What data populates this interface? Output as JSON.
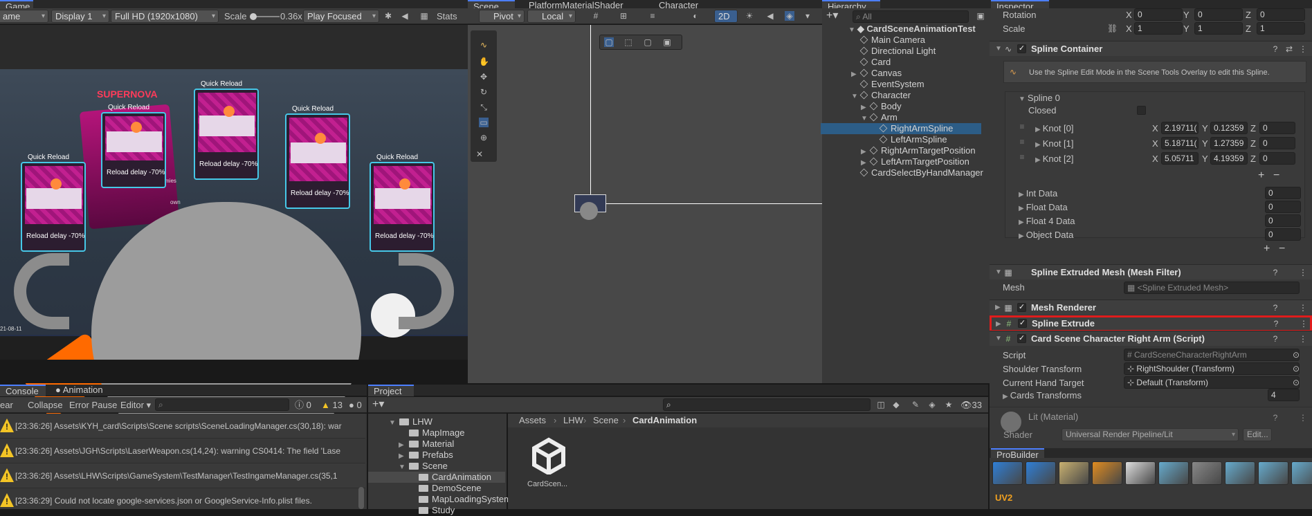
{
  "game": {
    "tab": "Game",
    "mode": "ame",
    "display": "Display 1",
    "resolution": "Full HD (1920x1080)",
    "scale_label": "Scale",
    "scale_value": "0.36x",
    "play": "Play Focused",
    "stats": "Stats",
    "supernova": "SUPERNOVA",
    "card_title": "Quick Reload",
    "card_text": "Reload delay -70%",
    "date": "21-08-11",
    "frag1": "mies",
    "frag2": "own"
  },
  "scene": {
    "tabs": [
      "Scene",
      "PlatformMaterialShader",
      "Character"
    ],
    "pivot": "Pivot",
    "local": "Local",
    "mode2d": "2D"
  },
  "hierarchy": {
    "tab": "Hierarchy",
    "search": "All",
    "root": "CardSceneAnimationTest",
    "items": [
      "Main Camera",
      "Directional Light",
      "Card",
      "Canvas",
      "EventSystem",
      "Character",
      "Body",
      "Arm",
      "RightArmSpline",
      "LeftArmSpline",
      "RightArmTargetPosition",
      "LeftArmTargetPosition",
      "CardSelectByHandManager"
    ]
  },
  "inspector": {
    "tab": "Inspector",
    "rotation": {
      "label": "Rotation",
      "x": "0",
      "y": "0",
      "z": "0"
    },
    "scale": {
      "label": "Scale",
      "x": "1",
      "y": "1",
      "z": "1"
    },
    "spline_container": {
      "title": "Spline Container",
      "info": "Use the Spline Edit Mode in the Scene Tools Overlay to edit this Spline.",
      "spline": "Spline 0",
      "closed": "Closed",
      "knots": [
        {
          "name": "Knot [0]",
          "x": "2.19711(",
          "y": "0.12359",
          "z": "0"
        },
        {
          "name": "Knot [1]",
          "x": "5.18711(",
          "y": "1.27359",
          "z": "0"
        },
        {
          "name": "Knot [2]",
          "x": "5.05711",
          "y": "4.19359",
          "z": "0"
        }
      ],
      "data": [
        {
          "label": "Int Data",
          "value": "0"
        },
        {
          "label": "Float Data",
          "value": "0"
        },
        {
          "label": "Float 4 Data",
          "value": "0"
        },
        {
          "label": "Object Data",
          "value": "0"
        }
      ]
    },
    "mesh_filter": {
      "title": "Spline Extruded Mesh  (Mesh Filter)",
      "mesh_label": "Mesh",
      "mesh_value": "<Spline Extruded Mesh>"
    },
    "mesh_renderer": "Mesh Renderer",
    "spline_extrude": "Spline Extrude",
    "script_comp": {
      "title": "Card Scene Character Right Arm (Script)",
      "fields": [
        {
          "label": "Script",
          "value": "CardSceneCharacterRightArm"
        },
        {
          "label": "Shoulder Transform",
          "value": "RightShoulder (Transform)"
        },
        {
          "label": "Current Hand Target",
          "value": "Default (Transform)"
        }
      ],
      "cards_label": "Cards Transforms",
      "cards_value": "4"
    },
    "material": {
      "name": "Lit (Material)",
      "shader_label": "Shader",
      "shader_value": "Universal Render Pipeline/Lit",
      "edit": "Edit..."
    }
  },
  "console": {
    "tabs": [
      "Console",
      "Animation"
    ],
    "clear": "ear",
    "collapse": "Collapse",
    "error_pause": "Error Pause",
    "editor": "Editor",
    "counts": {
      "info": "0",
      "warn": "13",
      "error": "0"
    },
    "logs": [
      "[23:36:26] Assets\\KYH_card\\Scripts\\Scene scripts\\SceneLoadingManager.cs(30,18): war",
      "[23:36:26] Assets\\JGH\\Scripts\\LaserWeapon.cs(14,24): warning CS0414: The field 'Lase",
      "[23:36:26] Assets\\LHW\\Scripts\\GameSystem\\TestManager\\TestIngameManager.cs(35,1",
      "[23:36:29] Could not locate google-services.json or GoogleService-Info.plist files."
    ]
  },
  "project": {
    "tab": "Project",
    "hidden_count": "33",
    "tree": [
      "LHW",
      "MapImage",
      "Material",
      "Prefabs",
      "Scene",
      "CardAnimation",
      "DemoScene",
      "MapLoadingSystem",
      "Study"
    ],
    "breadcrumb": [
      "Assets",
      "LHW",
      "Scene",
      "CardAnimation"
    ],
    "asset": "CardScen..."
  },
  "probuilder": {
    "tab": "ProBuilder",
    "uv": "UV2"
  },
  "colors": {
    "accent": "#4c7fff",
    "selection": "#2c5d87",
    "highlight": "#e01c1c",
    "warning": "#f3c425"
  }
}
